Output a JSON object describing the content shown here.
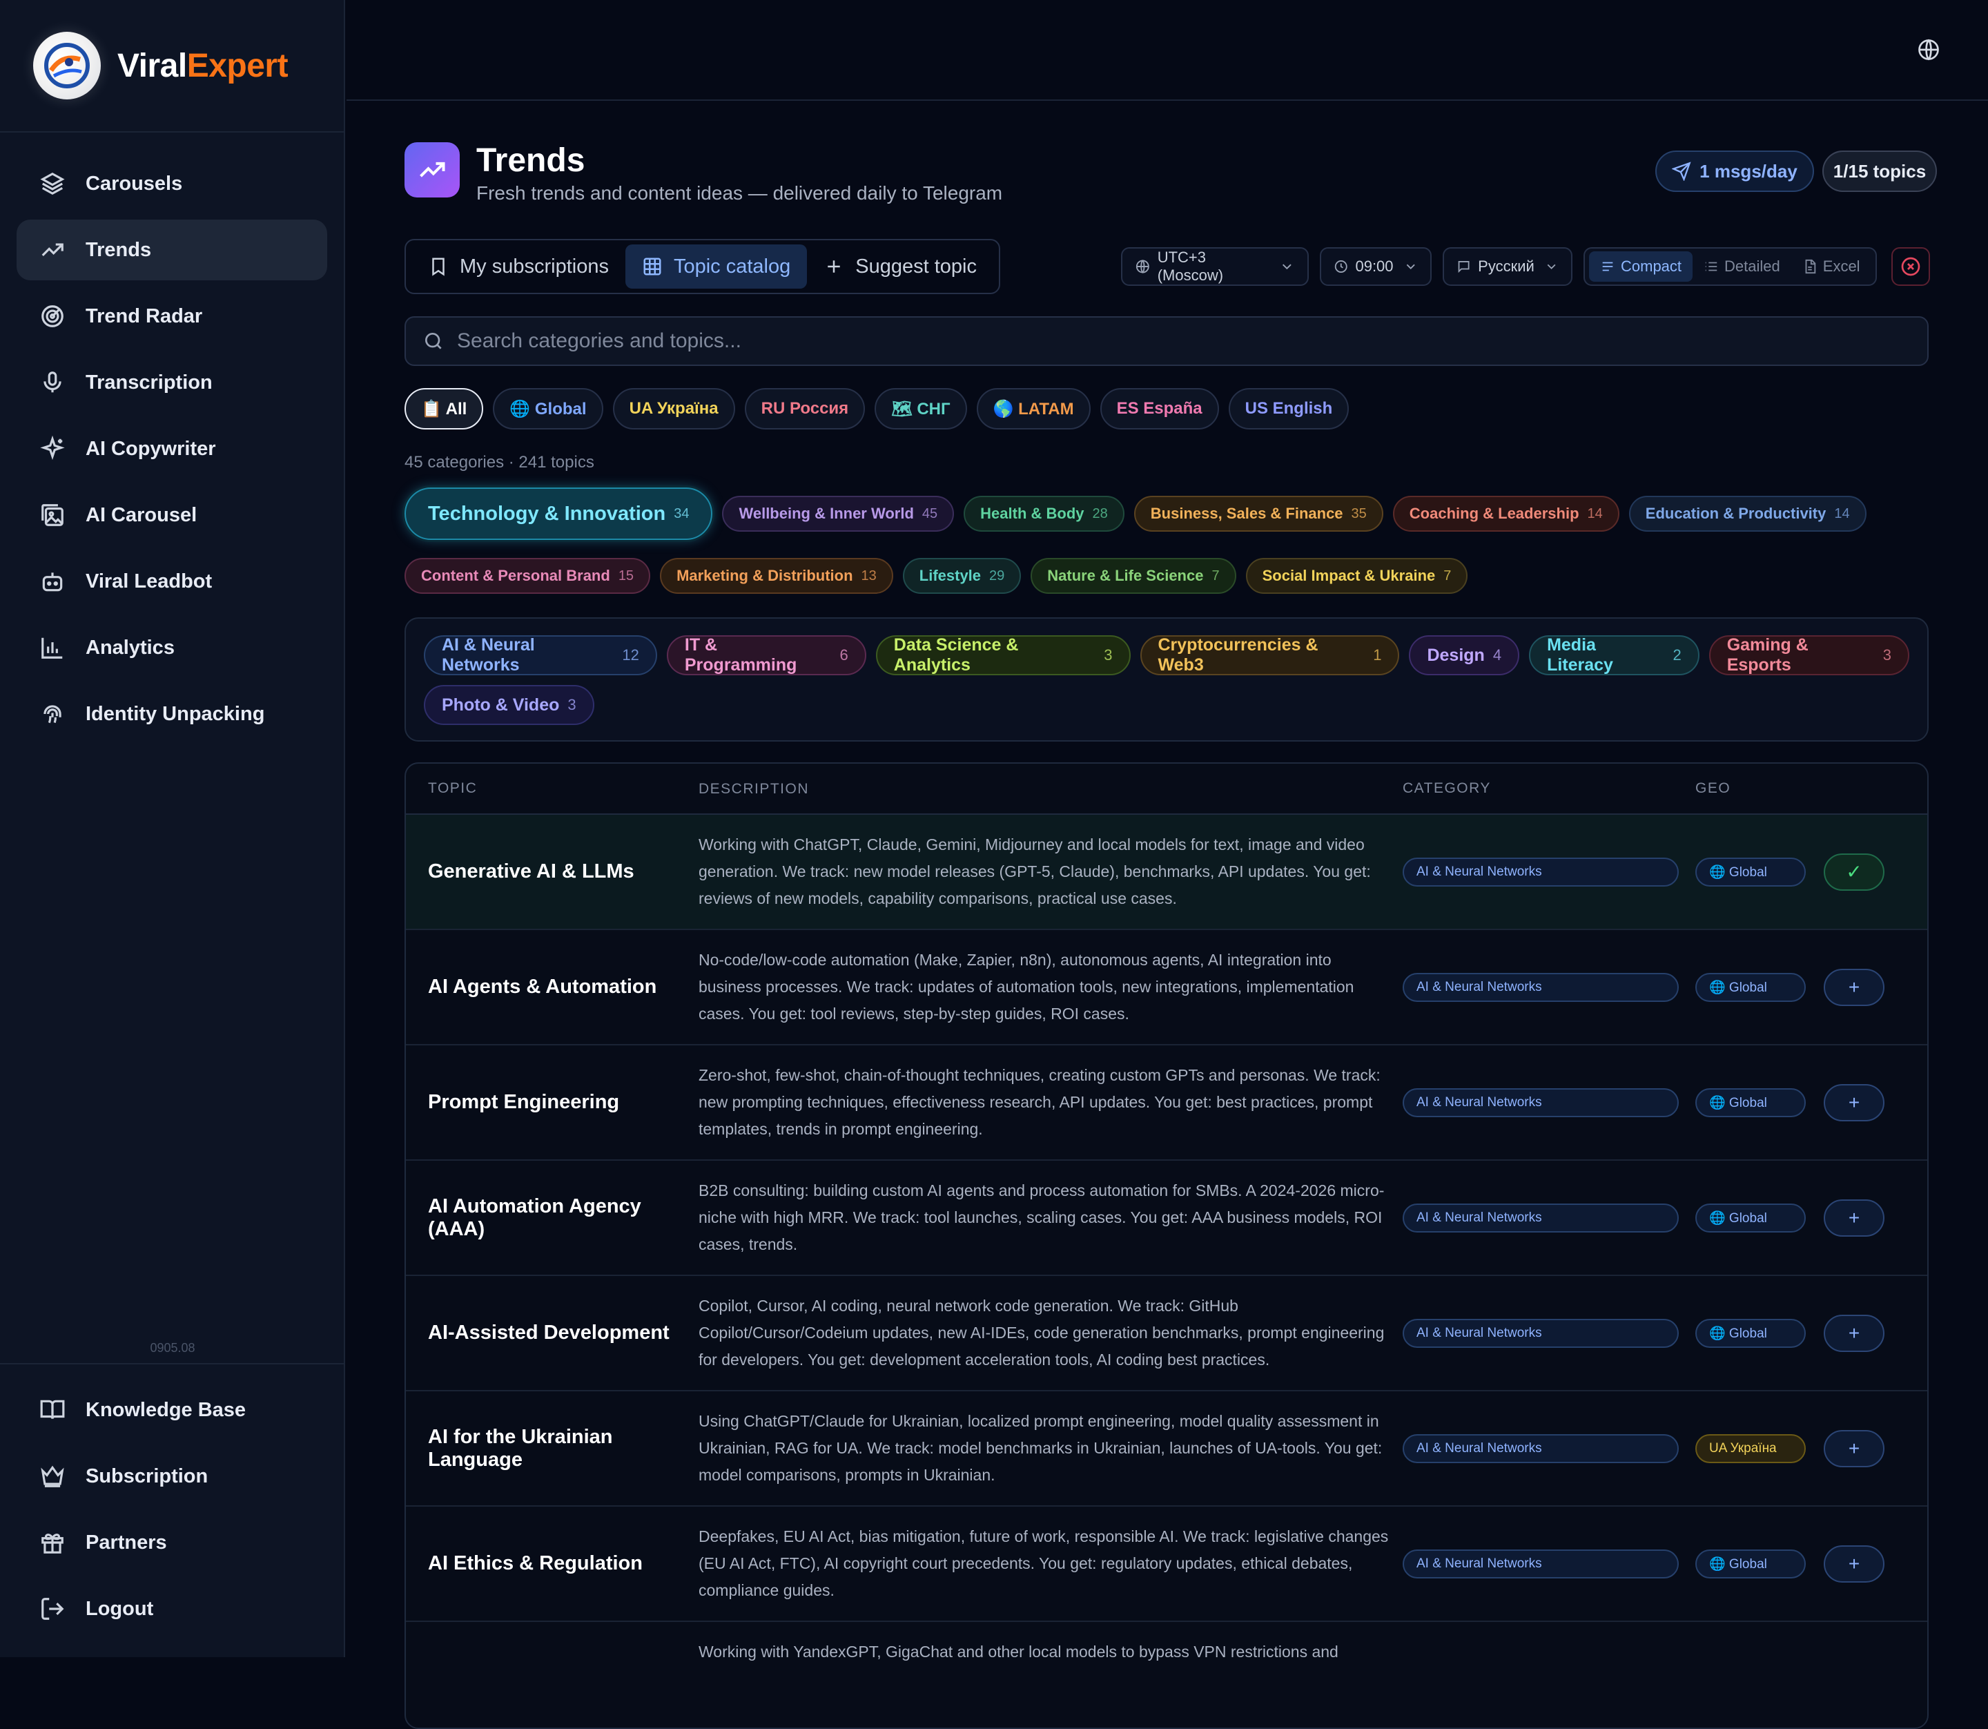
{
  "brand": {
    "name_a": "Viral",
    "name_b": "Expert",
    "accent": "#f97316"
  },
  "sidebar": {
    "items": [
      {
        "label": "Carousels",
        "icon": "layers-icon"
      },
      {
        "label": "Trends",
        "icon": "trending-up-icon",
        "active": true
      },
      {
        "label": "Trend Radar",
        "icon": "radar-icon"
      },
      {
        "label": "Transcription",
        "icon": "microphone-icon"
      },
      {
        "label": "AI Copywriter",
        "icon": "sparkles-icon"
      },
      {
        "label": "AI Carousel",
        "icon": "image-stack-icon"
      },
      {
        "label": "Viral Leadbot",
        "icon": "bot-icon"
      },
      {
        "label": "Analytics",
        "icon": "bar-chart-icon"
      },
      {
        "label": "Identity Unpacking",
        "icon": "fingerprint-icon"
      }
    ],
    "version": "0905.08",
    "bottom": [
      {
        "label": "Knowledge Base",
        "icon": "book-icon"
      },
      {
        "label": "Subscription",
        "icon": "crown-icon"
      },
      {
        "label": "Partners",
        "icon": "gift-icon"
      },
      {
        "label": "Logout",
        "icon": "logout-icon"
      }
    ]
  },
  "header": {
    "title": "Trends",
    "subtitle": "Fresh trends and content ideas — delivered daily to Telegram",
    "msgs": "1 msgs/day",
    "topics": "1/15 topics"
  },
  "tabs": {
    "subs": "My subscriptions",
    "catalog": "Topic catalog",
    "suggest": "Suggest topic"
  },
  "controls": {
    "timezone": "UTC+3 (Moscow)",
    "time": "09:00",
    "language": "Русский",
    "compact": "Compact",
    "detailed": "Detailed",
    "excel": "Excel"
  },
  "search": {
    "placeholder": "Search categories and topics..."
  },
  "geos": [
    {
      "label": "📋 All",
      "color": "#ffffff"
    },
    {
      "label": "🌐 Global",
      "color": "#7fa8ff"
    },
    {
      "label": "UA Україна",
      "color": "#f2d35a"
    },
    {
      "label": "RU Россия",
      "color": "#f07a8a"
    },
    {
      "label": "🗺 СНГ",
      "color": "#5fd3c6"
    },
    {
      "label": "🌎 LATAM",
      "color": "#f29a4a"
    },
    {
      "label": "ES España",
      "color": "#f07ab0"
    },
    {
      "label": "US English",
      "color": "#8f9bff"
    }
  ],
  "counts": "45 categories · 241 topics",
  "categories_row1": [
    {
      "label": "Technology & Innovation",
      "n": "34",
      "fg": "#7fe8ff",
      "bg": "#0c3a4a",
      "bd": "#1c8aa8",
      "big": true
    },
    {
      "label": "Wellbeing & Inner World",
      "n": "45",
      "fg": "#b89ae8",
      "bg": "#1a1430",
      "bd": "#3a2d5a"
    },
    {
      "label": "Health & Body",
      "n": "28",
      "fg": "#5fd3a0",
      "bg": "#0f2420",
      "bd": "#1f4a3c"
    },
    {
      "label": "Business, Sales & Finance",
      "n": "35",
      "fg": "#f2b25a",
      "bg": "#2a1f10",
      "bd": "#5a4220"
    },
    {
      "label": "Coaching & Leadership",
      "n": "14",
      "fg": "#f08a7a",
      "bg": "#2a1414",
      "bd": "#5a2a28"
    },
    {
      "label": "Education & Productivity",
      "n": "14",
      "fg": "#7fa8e8",
      "bg": "#101c30",
      "bd": "#22385a"
    }
  ],
  "categories_row2": [
    {
      "label": "Content & Personal Brand",
      "n": "15",
      "fg": "#e88ab8",
      "bg": "#2a1422",
      "bd": "#5a2a44"
    },
    {
      "label": "Marketing & Distribution",
      "n": "13",
      "fg": "#f2a05a",
      "bg": "#2a1c10",
      "bd": "#5a3a20"
    },
    {
      "label": "Lifestyle",
      "n": "29",
      "fg": "#5fd3c6",
      "bg": "#0f2426",
      "bd": "#1f4a4c"
    },
    {
      "label": "Nature & Life Science",
      "n": "7",
      "fg": "#8ad37a",
      "bg": "#142614",
      "bd": "#2a4a28"
    },
    {
      "label": "Social Impact & Ukraine",
      "n": "7",
      "fg": "#f2d35a",
      "bg": "#262010",
      "bd": "#4a4020"
    }
  ],
  "subcats_row1": [
    {
      "label": "AI & Neural Networks",
      "n": "12",
      "fg": "#8fb3ff",
      "bg": "#0f1c38",
      "bd": "#26406b"
    },
    {
      "label": "IT & Programming",
      "n": "6",
      "fg": "#f09ad0",
      "bg": "#2a1428",
      "bd": "#5a2a50"
    },
    {
      "label": "Data Science & Analytics",
      "n": "3",
      "fg": "#c8f06a",
      "bg": "#1c2a10",
      "bd": "#3c5a20"
    },
    {
      "label": "Cryptocurrencies & Web3",
      "n": "1",
      "fg": "#f2c25a",
      "bg": "#2a2010",
      "bd": "#5a4420"
    },
    {
      "label": "Design",
      "n": "4",
      "fg": "#c0a8ff",
      "bg": "#1c1434",
      "bd": "#3c2c6a"
    },
    {
      "label": "Media Literacy",
      "n": "2",
      "fg": "#6ae0f0",
      "bg": "#0f2830",
      "bd": "#1f5460"
    },
    {
      "label": "Gaming & Esports",
      "n": "3",
      "fg": "#f28a9a",
      "bg": "#2a1218",
      "bd": "#5a2432"
    }
  ],
  "subcats_row2": [
    {
      "label": "Photo & Video",
      "n": "3",
      "fg": "#a8a8ff",
      "bg": "#16163a",
      "bd": "#2e2e6a"
    }
  ],
  "table": {
    "headers": [
      "TOPIC",
      "DESCRIPTION",
      "CATEGORY",
      "GEO"
    ],
    "rows": [
      {
        "topic": "Generative AI & LLMs",
        "desc": "Working with ChatGPT, Claude, Gemini, Midjourney and local models for text, image and video generation. We track: new model releases (GPT-5, Claude), benchmarks, API updates. You get: reviews of new models, capability comparisons, practical use cases.",
        "category": "AI & Neural Networks",
        "geo": "🌐 Global",
        "ua": false,
        "action": "✓",
        "selected": true
      },
      {
        "topic": "AI Agents & Automation",
        "desc": "No-code/low-code automation (Make, Zapier, n8n), autonomous agents, AI integration into business processes. We track: updates of automation tools, new integrations, implementation cases. You get: tool reviews, step-by-step guides, ROI cases.",
        "category": "AI & Neural Networks",
        "geo": "🌐 Global",
        "ua": false,
        "action": "+",
        "selected": false
      },
      {
        "topic": "Prompt Engineering",
        "desc": "Zero-shot, few-shot, chain-of-thought techniques, creating custom GPTs and personas. We track: new prompting techniques, effectiveness research, API updates. You get: best practices, prompt templates, trends in prompt engineering.",
        "category": "AI & Neural Networks",
        "geo": "🌐 Global",
        "ua": false,
        "action": "+",
        "selected": false
      },
      {
        "topic": "AI Automation Agency (AAA)",
        "desc": "B2B consulting: building custom AI agents and process automation for SMBs. A 2024-2026 micro-niche with high MRR. We track: tool launches, scaling cases. You get: AAA business models, ROI cases, trends.",
        "category": "AI & Neural Networks",
        "geo": "🌐 Global",
        "ua": false,
        "action": "+",
        "selected": false
      },
      {
        "topic": "AI-Assisted Development",
        "desc": "Copilot, Cursor, AI coding, neural network code generation. We track: GitHub Copilot/Cursor/Codeium updates, new AI-IDEs, code generation benchmarks, prompt engineering for developers. You get: development acceleration tools, AI coding best practices.",
        "category": "AI & Neural Networks",
        "geo": "🌐 Global",
        "ua": false,
        "action": "+",
        "selected": false
      },
      {
        "topic": "AI for the Ukrainian Language",
        "desc": "Using ChatGPT/Claude for Ukrainian, localized prompt engineering, model quality assessment in Ukrainian, RAG for UA. We track: model benchmarks in Ukrainian, launches of UA-tools. You get: model comparisons, prompts in Ukrainian.",
        "category": "AI & Neural Networks",
        "geo": "UA Україна",
        "ua": true,
        "action": "+",
        "selected": false
      },
      {
        "topic": "AI Ethics & Regulation",
        "desc": "Deepfakes, EU AI Act, bias mitigation, future of work, responsible AI. We track: legislative changes (EU AI Act, FTC), AI copyright court precedents. You get: regulatory updates, ethical debates, compliance guides.",
        "category": "AI & Neural Networks",
        "geo": "🌐 Global",
        "ua": false,
        "action": "+",
        "selected": false
      },
      {
        "topic": "",
        "desc": "Working with YandexGPT, GigaChat and other local models to bypass VPN restrictions and",
        "category": "",
        "geo": "",
        "ua": false,
        "action": "",
        "selected": false
      }
    ]
  }
}
